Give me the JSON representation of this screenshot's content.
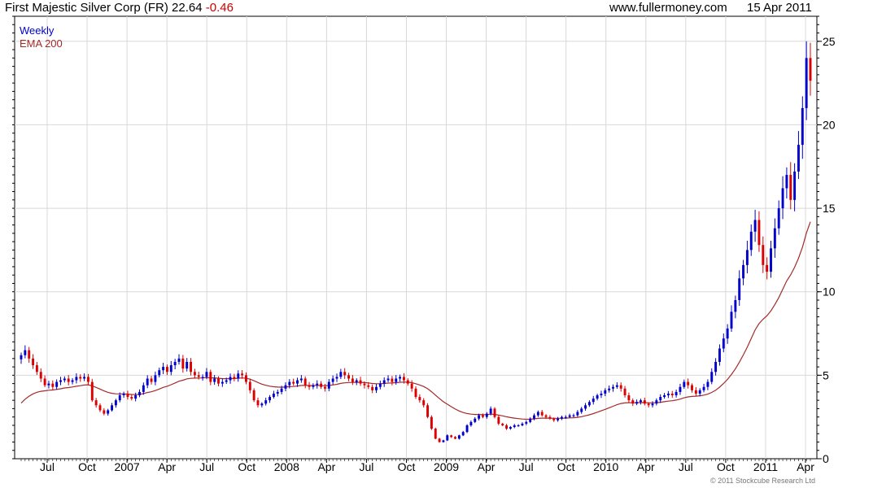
{
  "header": {
    "title": "First Majestic Silver Corp (FR) 22.64",
    "change": "-0.46",
    "site": "www.fullermoney.com",
    "date": "15 Apr 2011"
  },
  "legend": {
    "line1": "Weekly",
    "line2": "EMA 200"
  },
  "footer": {
    "copyright": "© 2011 Stockcube Research Ltd"
  },
  "colors": {
    "up": "#0000cc",
    "down": "#dd0000",
    "ema": "#a52a2a",
    "grid": "#d8d8d8"
  },
  "chart_data": {
    "type": "candlestick",
    "title": "First Majestic Silver Corp (FR) 22.64 -0.46",
    "period": "Weekly",
    "x_ticks": [
      "Jul",
      "Oct",
      "2007",
      "Apr",
      "Jul",
      "Oct",
      "2008",
      "Apr",
      "Jul",
      "Oct",
      "2009",
      "Apr",
      "Jul",
      "Oct",
      "2010",
      "Apr",
      "Jul",
      "Oct",
      "2011",
      "Apr"
    ],
    "y_ticks": [
      0,
      5,
      10,
      15,
      20,
      25
    ],
    "ylim": [
      0,
      26.5
    ],
    "series": [
      {
        "name": "Weekly",
        "close": [
          6.2,
          6.5,
          6.0,
          5.6,
          5.2,
          4.8,
          4.4,
          4.5,
          4.3,
          4.6,
          4.7,
          4.8,
          4.6,
          4.7,
          4.9,
          4.8,
          4.9,
          4.6,
          3.5,
          3.2,
          2.9,
          2.7,
          2.9,
          3.2,
          3.5,
          3.8,
          3.9,
          3.7,
          3.6,
          3.8,
          4.0,
          4.4,
          4.8,
          4.6,
          5.0,
          5.3,
          5.5,
          5.2,
          5.6,
          5.8,
          6.0,
          5.4,
          5.8,
          5.2,
          5.0,
          4.9,
          4.9,
          5.2,
          4.6,
          4.8,
          4.5,
          4.6,
          4.7,
          4.9,
          4.8,
          5.1,
          5.0,
          4.6,
          4.1,
          3.5,
          3.2,
          3.3,
          3.5,
          3.7,
          3.9,
          4.0,
          4.2,
          4.4,
          4.6,
          4.5,
          4.7,
          4.8,
          4.4,
          4.3,
          4.4,
          4.5,
          4.3,
          4.2,
          4.6,
          4.8,
          4.9,
          5.2,
          5.0,
          4.8,
          4.6,
          4.7,
          4.5,
          4.4,
          4.3,
          4.1,
          4.3,
          4.5,
          4.7,
          4.8,
          4.6,
          4.8,
          4.9,
          4.7,
          4.5,
          4.2,
          3.7,
          3.5,
          3.2,
          2.5,
          1.8,
          1.2,
          1.0,
          1.1,
          1.4,
          1.3,
          1.2,
          1.4,
          1.6,
          2.0,
          2.2,
          2.4,
          2.6,
          2.5,
          2.7,
          3.0,
          2.5,
          2.1,
          2.0,
          1.8,
          1.9,
          2.0,
          2.0,
          2.1,
          2.2,
          2.4,
          2.6,
          2.8,
          2.6,
          2.5,
          2.4,
          2.3,
          2.4,
          2.5,
          2.5,
          2.6,
          2.6,
          2.8,
          3.0,
          3.2,
          3.4,
          3.6,
          3.8,
          3.9,
          4.1,
          4.2,
          4.3,
          4.4,
          4.2,
          3.8,
          3.5,
          3.3,
          3.4,
          3.5,
          3.3,
          3.2,
          3.3,
          3.5,
          3.7,
          3.8,
          3.9,
          3.8,
          4.0,
          4.3,
          4.6,
          4.4,
          4.1,
          3.9,
          4.1,
          4.3,
          4.6,
          5.2,
          5.8,
          6.6,
          7.2,
          7.8,
          8.8,
          9.5,
          10.8,
          11.6,
          12.5,
          13.6,
          14.3,
          12.8,
          11.6,
          11.2,
          12.6,
          13.8,
          15.0,
          16.2,
          17.0,
          15.5,
          17.2,
          18.8,
          21.0,
          24.0,
          22.64
        ]
      },
      {
        "name": "EMA 200"
      }
    ]
  }
}
